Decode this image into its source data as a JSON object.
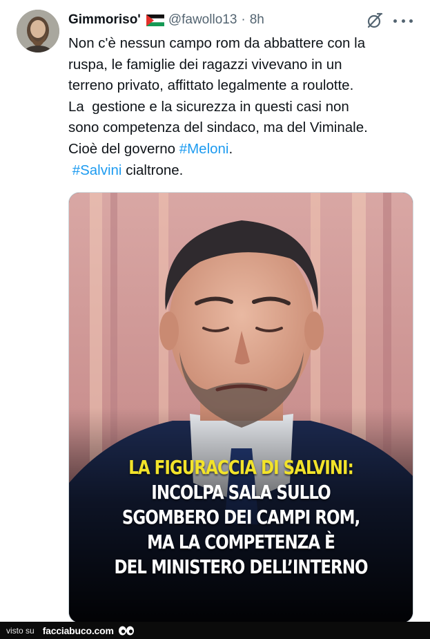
{
  "tweet": {
    "author_name": "Gimmoriso'",
    "handle": "@fawollo13",
    "separator": "·",
    "time": "8h",
    "lines": [
      "Non c'è nessun campo rom da abbattere con la",
      "ruspa, le famiglie dei ragazzi vivevano in un",
      "terreno privato, affittato legalmente a roulotte.",
      "La  gestione e la sicurezza in questi casi non",
      "sono competenza del sindaco, ma del Viminale."
    ],
    "line6_text": "Cioè del governo ",
    "line6_hashtag": "#Meloni",
    "line6_end": ".",
    "line7_hashtag": " #Salvini",
    "line7_text": " cialtrone."
  },
  "media": {
    "caption_line1": "LA FIGURACCIA DI SALVINI:",
    "caption_lines": [
      "INCOLPA SALA SULLO",
      "SGOMBERO DEI CAMPI ROM,",
      "MA LA COMPETENZA È",
      "DEL MINISTERO DELL’INTERNO"
    ]
  },
  "footer": {
    "visto_label": "visto su",
    "brand": "facciabuco.com"
  },
  "icons": {
    "flag": "palestine-flag-icon",
    "grok": "grok-icon",
    "more": "more-icon",
    "eyes": "eyes-icon"
  },
  "colors": {
    "hashtag": "#1d9bf0",
    "caption_highlight": "#f2e32a",
    "text": "#0f1419",
    "secondary": "#536471"
  }
}
